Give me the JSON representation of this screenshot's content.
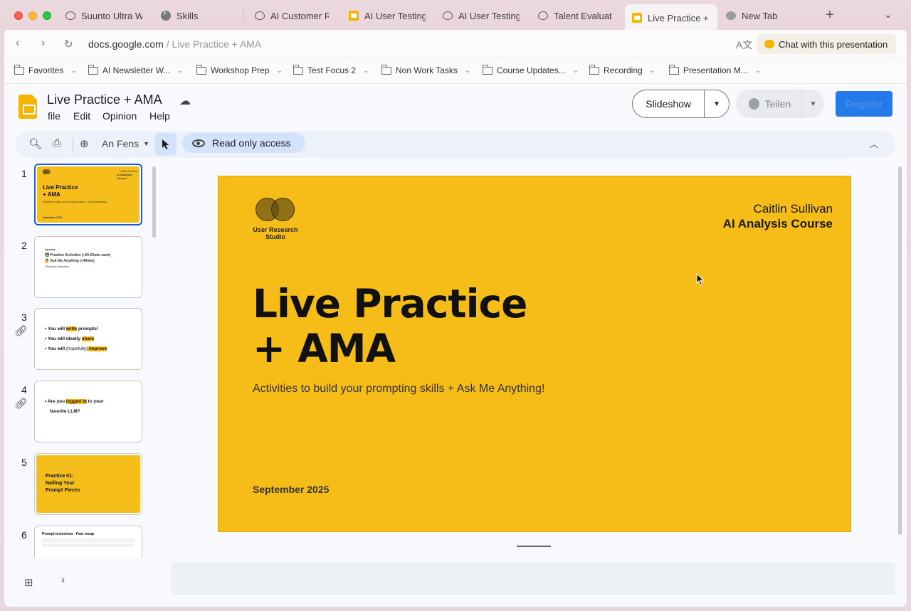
{
  "browser": {
    "tabs": [
      {
        "label": "Suunto Ultra Wa",
        "icon": "chat-icon"
      },
      {
        "label": "Skills",
        "icon": "skills-icon"
      },
      {
        "label": "AI Customer Re",
        "icon": "chat-icon"
      },
      {
        "label": "AI User Testing",
        "icon": "slides-icon"
      },
      {
        "label": "AI User Testing",
        "icon": "chat-icon"
      },
      {
        "label": "Talent Evaluatio",
        "icon": "chat-icon"
      },
      {
        "label": "Live Practice + A",
        "icon": "slides-icon",
        "active": true
      },
      {
        "label": "New Tab",
        "icon": "newtab-icon"
      }
    ],
    "url_domain": "docs.google.com",
    "url_path": " / Live Practice + AMA",
    "chat_button": "Chat with this presentation",
    "bookmarks": [
      {
        "label": "Favorites"
      },
      {
        "label": "AI Newsletter W..."
      },
      {
        "label": "Workshop Prep"
      },
      {
        "label": "Test Focus 2"
      },
      {
        "label": "Non Work Tasks"
      },
      {
        "label": "Course Updates..."
      },
      {
        "label": "Recording"
      },
      {
        "label": "Presentation M..."
      }
    ]
  },
  "app": {
    "doc_title": "Live Practice + AMA",
    "menu": [
      "file",
      "Edit",
      "Opinion",
      "Help"
    ],
    "slideshow_label": "Slideshow",
    "share_label": "Teilen",
    "register_label": "Register",
    "zoom_label": "An Fens",
    "read_only_label": "Read only access"
  },
  "filmstrip": {
    "numbers": [
      "1",
      "2",
      "3",
      "4",
      "5",
      "6"
    ],
    "slide1": {
      "title": "Live Practice\n+ AMA",
      "author": "Caitlin Sullivan",
      "course": "AI Analysis Course",
      "studio": "User Research Studio",
      "subtitle": "Activities to build your prompting skills + Ask Me Anything!",
      "date": "September 2025"
    },
    "slide2": {
      "heading": "Agenda",
      "line1": "Practice Activities (≈20-25min each)",
      "line2": "Ask Me Anything (≈40min)",
      "line3": "(Times are estimates)"
    },
    "slide3": {
      "l1a": "You will ",
      "l1b": "write",
      "l1c": " prompts!",
      "l2a": "You will ideally ",
      "l2b": "share",
      "l3a": "You will ",
      "l3b": "(hopefully)",
      "l3c": " improve"
    },
    "slide4": {
      "l1a": "Are you ",
      "l1b": "logged in",
      "l1c": " to your",
      "l2": "favorite LLM?"
    },
    "slide5": {
      "title": "Practice 01:\nNailing Your\nPrompt Pieces"
    },
    "slide6": {
      "title": "Prompt inclusions - Fast recap"
    }
  },
  "slide": {
    "studio_name": "User Research Studio",
    "author": "Caitlin Sullivan",
    "course": "AI Analysis Course",
    "title_line1": "Live Practice",
    "title_line2": "+ AMA",
    "subtitle": "Activities to build your prompting skills + Ask Me Anything!",
    "date": "September 2025"
  }
}
